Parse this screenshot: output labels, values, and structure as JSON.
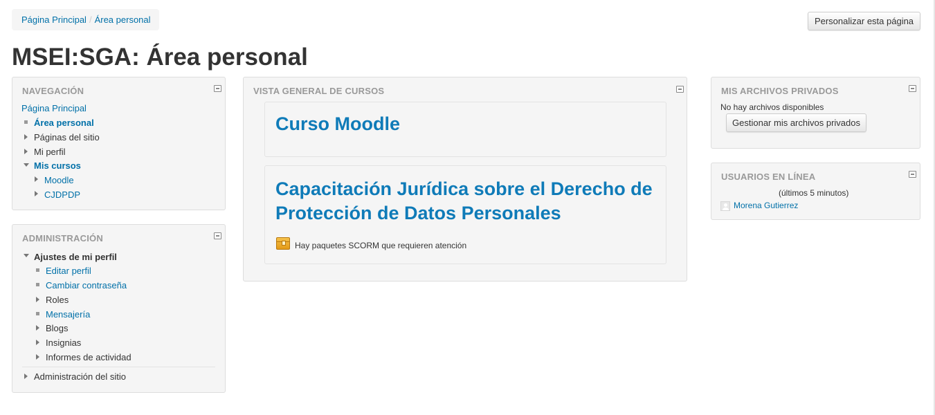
{
  "breadcrumb": {
    "home": "Página Principal",
    "separator": "/",
    "current": "Área personal"
  },
  "header": {
    "title": "MSEI:SGA: Área personal",
    "customize_button": "Personalizar esta página"
  },
  "navigation": {
    "title": "NAVEGACIÓN",
    "home": "Página Principal",
    "area_personal": "Área personal",
    "site_pages": "Páginas del sitio",
    "my_profile": "Mi perfil",
    "my_courses": "Mis cursos",
    "course_1": "Moodle",
    "course_2": "CJDPDP"
  },
  "administration": {
    "title": "ADMINISTRACIÓN",
    "profile_settings": "Ajustes de mi perfil",
    "edit_profile": "Editar perfil",
    "change_password": "Cambiar contraseña",
    "roles": "Roles",
    "messaging": "Mensajería",
    "blogs": "Blogs",
    "badges": "Insignias",
    "activity_reports": "Informes de actividad",
    "site_admin": "Administración del sitio"
  },
  "course_overview": {
    "title": "VISTA GENERAL DE CURSOS",
    "courses": [
      {
        "name": "Curso Moodle"
      },
      {
        "name": "Capacitación Jurídica sobre el Derecho de Protección de Datos Personales",
        "notice": "Hay paquetes SCORM que requieren atención"
      }
    ]
  },
  "private_files": {
    "title": "MIS ARCHIVOS PRIVADOS",
    "empty_text": "No hay archivos disponibles",
    "manage_button": "Gestionar mis archivos privados"
  },
  "online_users": {
    "title": "USUARIOS EN LÍNEA",
    "period": "(últimos 5 minutos)",
    "users": [
      "Morena Gutierrez"
    ]
  },
  "icons": {
    "collapse": "collapse-icon",
    "tree_expand": "arrow-right-icon",
    "tree_collapse": "arrow-down-icon",
    "leaf": "bullet-icon",
    "scorm": "scorm-package-icon",
    "user": "user-avatar-icon"
  },
  "colors": {
    "link": "#0070a8",
    "course_title": "#0f7bb8",
    "block_bg": "#f5f5f5",
    "block_title": "#999999"
  }
}
